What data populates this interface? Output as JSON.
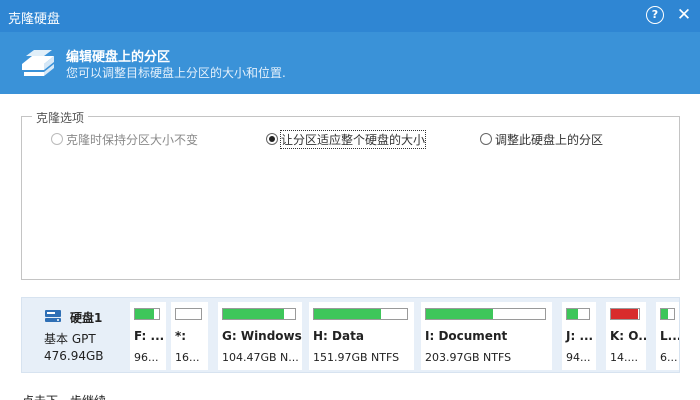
{
  "window": {
    "title": "克隆硬盘",
    "help_symbol": "?",
    "close_symbol": "✕"
  },
  "header": {
    "title": "编辑硬盘上的分区",
    "subtitle": "您可以调整目标硬盘上分区的大小和位置.",
    "icon": "disk-stack-icon"
  },
  "clone_options": {
    "legend": "克隆选项",
    "options": [
      {
        "label": "克隆时保持分区大小不变",
        "checked": false,
        "enabled": false
      },
      {
        "label": "让分区适应整个硬盘的大小",
        "checked": true,
        "enabled": true
      },
      {
        "label": "调整此硬盘上的分区",
        "checked": false,
        "enabled": true
      }
    ]
  },
  "disk": {
    "name": "硬盘1",
    "type": "基本 GPT",
    "size": "476.94GB",
    "icon": "hard-disk-icon",
    "partitions": [
      {
        "label": "F: ...",
        "size": "96...",
        "fill": 0.8,
        "color": "#3ec65a"
      },
      {
        "label": "*:",
        "size": "16...",
        "fill": 0.0,
        "color": "#3ec65a"
      },
      {
        "label": "G: Windows",
        "size": "104.47GB N...",
        "fill": 0.85,
        "color": "#3ec65a"
      },
      {
        "label": "H: Data",
        "size": "151.97GB NTFS",
        "fill": 0.72,
        "color": "#3ec65a"
      },
      {
        "label": "I: Document",
        "size": "203.97GB NTFS",
        "fill": 0.56,
        "color": "#3ec65a"
      },
      {
        "label": "J: ...",
        "size": "94...",
        "fill": 0.5,
        "color": "#3ec65a"
      },
      {
        "label": "K: O...",
        "size": "14....",
        "fill": 0.95,
        "color": "#d82c2c"
      },
      {
        "label": "L...",
        "size": "6...",
        "fill": 0.5,
        "color": "#3ec65a"
      }
    ]
  },
  "footer": {
    "text": "点击下一步继续。"
  }
}
